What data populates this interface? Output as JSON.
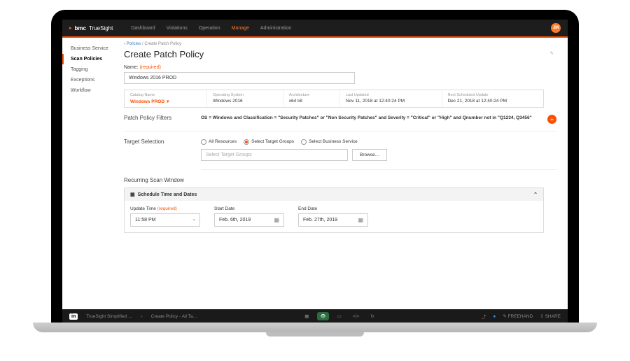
{
  "brand": {
    "logo_text": "bmc",
    "product": "TrueSight"
  },
  "nav": {
    "items": [
      "Dashboard",
      "Violations",
      "Operation",
      "Manage",
      "Administration"
    ],
    "active": "Manage"
  },
  "avatar": "JM",
  "sidebar": {
    "items": [
      "Business Service",
      "Scan Policies",
      "Tagging",
      "Exceptions",
      "Workflow"
    ],
    "active": "Scan Policies"
  },
  "crumbs": {
    "back": "‹ Policies",
    "sep": " / ",
    "current": "Create Patch Policy"
  },
  "title": "Create Patch Policy",
  "name_field": {
    "label": "Name:",
    "required": "(required)",
    "value": "Windows 2016 PROD"
  },
  "catalog": {
    "name_k": "Catalog Name",
    "name_v": "Windows PROD",
    "os_k": "Operating System",
    "os_v": "Windows 2016",
    "arch_k": "Architecture",
    "arch_v": "x64 bit",
    "lu_k": "Last Updated",
    "lu_v": "Nov 11, 2018 at 12:40:24 PM",
    "ns_k": "Next Scheduled Update",
    "ns_v": "Dec 21, 2018 at 12:40:24 PM"
  },
  "filters": {
    "label": "Patch Policy  Filters",
    "text": "OS = Windows and Classification = \"Security Patches\" or \"Non Security Patches\" and Severity = \"Critical\" or \"High\" and Qnumber not in \"Q1234, Q3456\""
  },
  "target": {
    "label": "Target Selection",
    "opts": [
      "All Resources",
      "Select Target Groups",
      "Select Business Service"
    ],
    "selected": 1,
    "placeholder": "Select Target Groups",
    "browse": "Browse…"
  },
  "recurring": {
    "label": "Recurring Scan Window",
    "panel": "Schedule Time and Dates",
    "update_k": "Update Time",
    "update_req": "(required)",
    "update_v": "11:58 PM",
    "start_k": "Start Date",
    "start_v": "Feb. 6th, 2019",
    "end_k": "End Date",
    "end_v": "Feb. 27th, 2019"
  },
  "invision": {
    "crumb1": "TrueSight Simplified …",
    "crumb2": "Create Policy - All Ta…",
    "freehand": "FREEHAND",
    "share": "SHARE"
  }
}
